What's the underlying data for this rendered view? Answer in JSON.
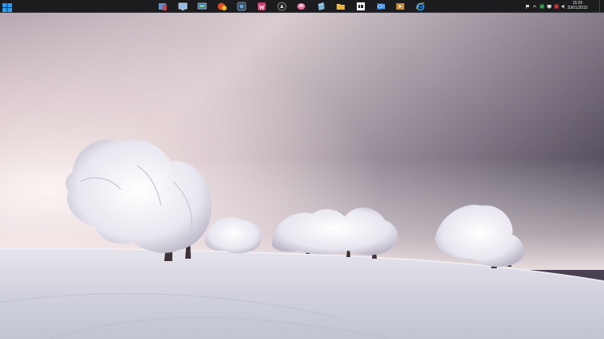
{
  "taskbar": {
    "start": {
      "icon": "windows-logo-icon"
    },
    "pinned_apps": [
      {
        "icon": "app-icon-1"
      },
      {
        "icon": "app-icon-2"
      },
      {
        "icon": "app-icon-3"
      },
      {
        "icon": "app-icon-4"
      },
      {
        "icon": "app-icon-5"
      },
      {
        "icon": "app-icon-6"
      },
      {
        "icon": "app-icon-7"
      },
      {
        "icon": "app-icon-8"
      },
      {
        "icon": "app-icon-9"
      },
      {
        "icon": "app-icon-10"
      },
      {
        "icon": "app-icon-11"
      },
      {
        "icon": "app-icon-12"
      },
      {
        "icon": "app-icon-13"
      },
      {
        "icon": "internet-explorer-icon"
      }
    ],
    "tray": {
      "clock_time": "15:20",
      "clock_date": "20/01/2015"
    }
  },
  "colors": {
    "taskbar_bg": "#1c1c1f",
    "accent": "#1e90ff"
  }
}
